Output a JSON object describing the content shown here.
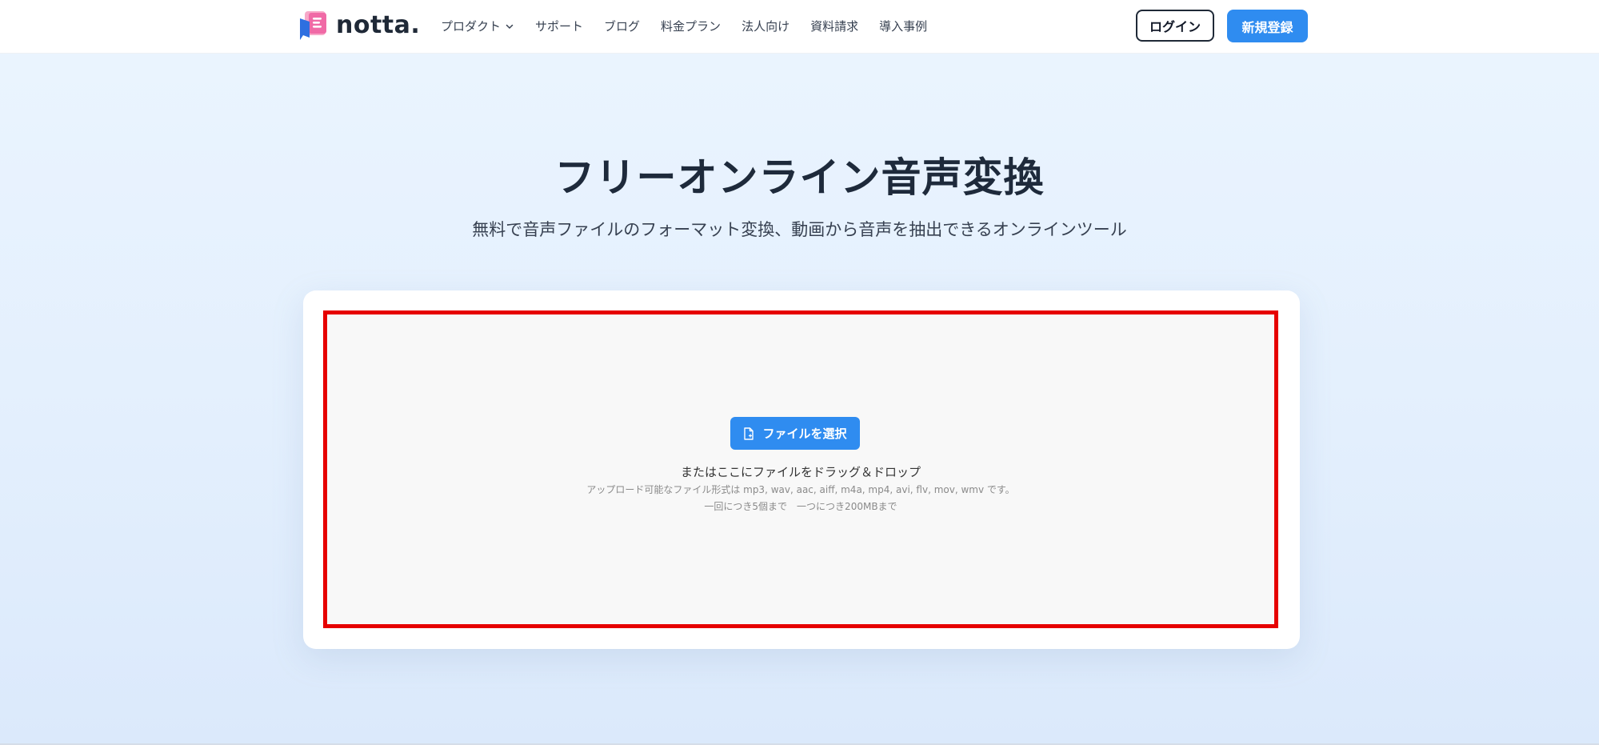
{
  "header": {
    "logo_text": "notta.",
    "nav": [
      {
        "label": "プロダクト",
        "has_dropdown": true
      },
      {
        "label": "サポート"
      },
      {
        "label": "ブログ"
      },
      {
        "label": "料金プラン"
      },
      {
        "label": "法人向け"
      },
      {
        "label": "資料請求"
      },
      {
        "label": "導入事例"
      }
    ],
    "login_label": "ログイン",
    "signup_label": "新規登録"
  },
  "hero": {
    "title": "フリーオンライン音声変換",
    "subtitle": "無料で音声ファイルのフォーマット変換、動画から音声を抽出できるオンラインツール"
  },
  "upload": {
    "select_button_label": "ファイルを選択",
    "drop_text": "またはここにファイルをドラッグ＆ドロップ",
    "formats_text": "アップロード可能なファイル形式は mp3, wav, aac, aiff, m4a, mp4, avi, flv, mov, wmv です。",
    "limits_text": "一回につき5個まで　一つにつき200MBまで"
  },
  "colors": {
    "brand_blue": "#2f8cf0",
    "highlight_red": "#e60000",
    "text_dark": "#1e2a3b"
  },
  "icons": {
    "logo": "notta-logo-icon",
    "dropdown": "chevron-down-icon",
    "file": "file-icon"
  }
}
